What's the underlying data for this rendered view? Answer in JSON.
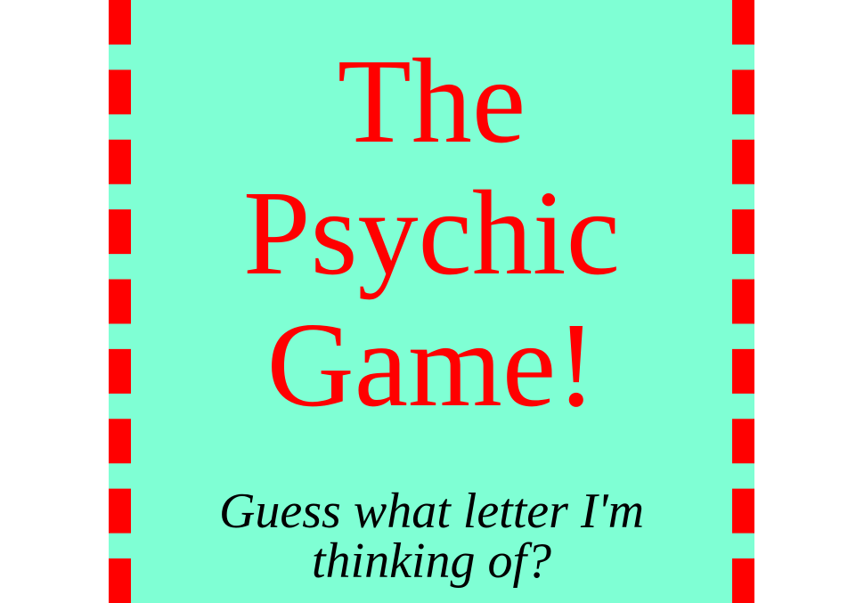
{
  "game": {
    "title_lines": [
      "The",
      "Psychic",
      "Game!"
    ],
    "subtitle": "Guess what letter I'm thinking of?"
  },
  "colors": {
    "panel_background": "#7fffd4",
    "border_dashes": "#ff0000",
    "title_text": "#ff0000",
    "subtitle_text": "#000000",
    "page_background": "#ffffff"
  }
}
